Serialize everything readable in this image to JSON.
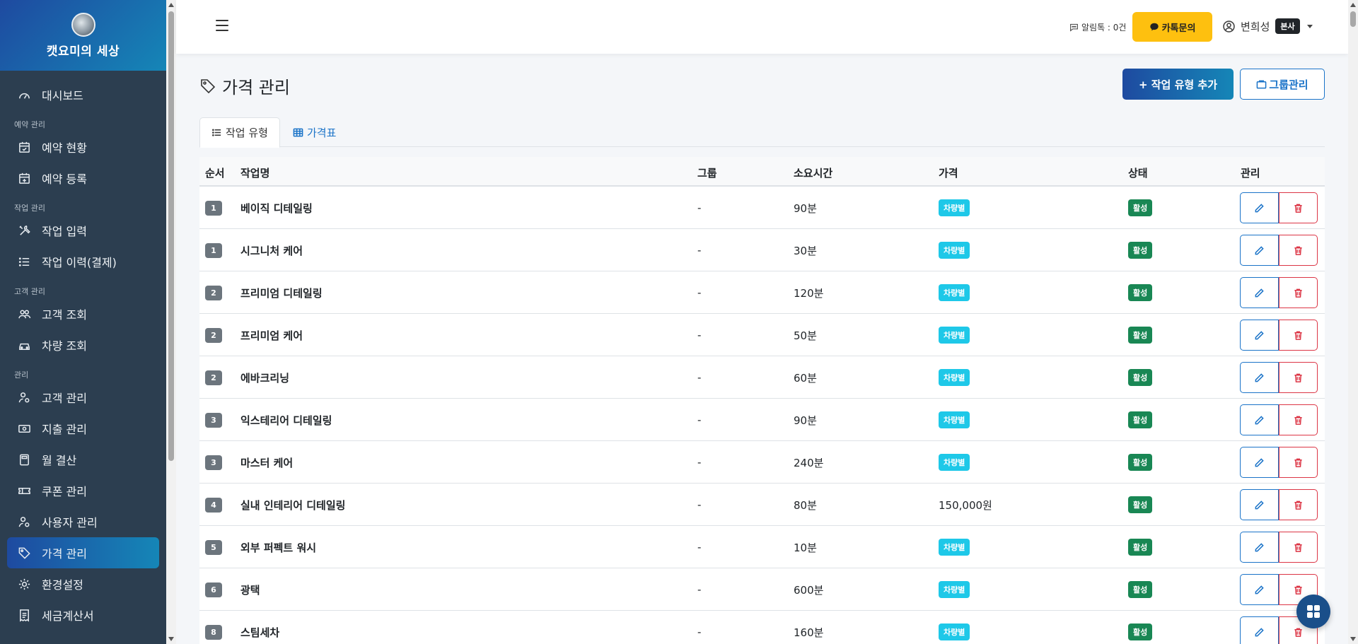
{
  "brand": {
    "name": "캣요미의 세상"
  },
  "sidebar": {
    "items": [
      {
        "type": "item",
        "label": "대시보드",
        "icon": "gauge-icon",
        "active": false
      },
      {
        "type": "section",
        "label": "예약 관리"
      },
      {
        "type": "item",
        "label": "예약 현황",
        "icon": "calendar-check-icon",
        "active": false
      },
      {
        "type": "item",
        "label": "예약 등록",
        "icon": "calendar-plus-icon",
        "active": false
      },
      {
        "type": "section",
        "label": "작업 관리"
      },
      {
        "type": "item",
        "label": "작업 입력",
        "icon": "tools-icon",
        "active": false
      },
      {
        "type": "item",
        "label": "작업 이력(결제)",
        "icon": "list-icon",
        "active": false
      },
      {
        "type": "section",
        "label": "고객 관리"
      },
      {
        "type": "item",
        "label": "고객 조회",
        "icon": "people-icon",
        "active": false
      },
      {
        "type": "item",
        "label": "차량 조회",
        "icon": "car-icon",
        "active": false
      },
      {
        "type": "section",
        "label": "관리"
      },
      {
        "type": "item",
        "label": "고객 관리",
        "icon": "person-gear-icon",
        "active": false
      },
      {
        "type": "item",
        "label": "지출 관리",
        "icon": "cash-icon",
        "active": false
      },
      {
        "type": "item",
        "label": "월 결산",
        "icon": "calculator-icon",
        "active": false
      },
      {
        "type": "item",
        "label": "쿠폰 관리",
        "icon": "ticket-icon",
        "active": false
      },
      {
        "type": "item",
        "label": "사용자 관리",
        "icon": "person-gear-icon",
        "active": false
      },
      {
        "type": "item",
        "label": "가격 관리",
        "icon": "tags-icon",
        "active": true
      },
      {
        "type": "item",
        "label": "환경설정",
        "icon": "gear-icon",
        "active": false
      },
      {
        "type": "item",
        "label": "세금계산서",
        "icon": "receipt-icon",
        "active": false
      }
    ]
  },
  "topbar": {
    "alarm": "알림톡 : 0건",
    "kakao_label": "카톡문의",
    "user_name": "변희성",
    "user_badge": "본사"
  },
  "page": {
    "title": "가격 관리",
    "add_button": "+ 작업 유형 추가",
    "group_button": "그룹관리",
    "tabs": [
      {
        "label": "작업 유형",
        "active": true
      },
      {
        "label": "가격표",
        "active": false
      }
    ]
  },
  "table": {
    "headers": [
      "순서",
      "작업명",
      "그룹",
      "소요시간",
      "가격",
      "상태",
      "관리"
    ],
    "rows": [
      {
        "order": "1",
        "name": "베이직 디테일링",
        "group": "-",
        "duration": "90분",
        "price": "차량별",
        "price_type": "badge",
        "status": "활성"
      },
      {
        "order": "1",
        "name": "시그니처 케어",
        "group": "-",
        "duration": "30분",
        "price": "차량별",
        "price_type": "badge",
        "status": "활성"
      },
      {
        "order": "2",
        "name": "프리미엄 디테일링",
        "group": "-",
        "duration": "120분",
        "price": "차량별",
        "price_type": "badge",
        "status": "활성"
      },
      {
        "order": "2",
        "name": "프리미엄 케어",
        "group": "-",
        "duration": "50분",
        "price": "차량별",
        "price_type": "badge",
        "status": "활성"
      },
      {
        "order": "2",
        "name": "에바크리닝",
        "group": "-",
        "duration": "60분",
        "price": "차량별",
        "price_type": "badge",
        "status": "활성"
      },
      {
        "order": "3",
        "name": "익스테리어 디테일링",
        "group": "-",
        "duration": "90분",
        "price": "차량별",
        "price_type": "badge",
        "status": "활성"
      },
      {
        "order": "3",
        "name": "마스터 케어",
        "group": "-",
        "duration": "240분",
        "price": "차량별",
        "price_type": "badge",
        "status": "활성"
      },
      {
        "order": "4",
        "name": "실내 인테리어 디테일링",
        "group": "-",
        "duration": "80분",
        "price": "150,000원",
        "price_type": "text",
        "status": "활성"
      },
      {
        "order": "5",
        "name": "외부 퍼펙트 워시",
        "group": "-",
        "duration": "10분",
        "price": "차량별",
        "price_type": "badge",
        "status": "활성"
      },
      {
        "order": "6",
        "name": "광택",
        "group": "-",
        "duration": "600분",
        "price": "차량별",
        "price_type": "badge",
        "status": "활성"
      },
      {
        "order": "8",
        "name": "스팀세차",
        "group": "-",
        "duration": "160분",
        "price": "차량별",
        "price_type": "badge",
        "status": "활성"
      }
    ]
  },
  "colors": {
    "accent": "#1a73c8",
    "sidebar_bg": "#2c3e50",
    "kakao": "#fec00f",
    "active_green": "#198754",
    "price_cyan": "#1ec8e8",
    "danger": "#dc3545"
  },
  "fab": {
    "icon": "grid-icon"
  }
}
